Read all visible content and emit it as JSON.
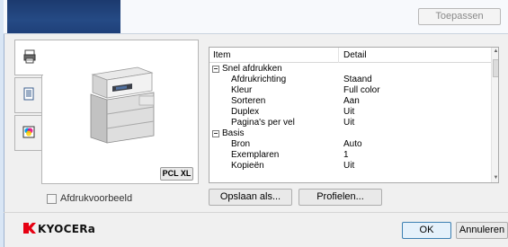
{
  "header": {
    "apply_label": "Toepassen"
  },
  "tabs": [
    {
      "icon": "printer-settings-icon"
    },
    {
      "icon": "document-icon"
    },
    {
      "icon": "color-icon"
    }
  ],
  "preview": {
    "badge": "PCL XL",
    "checkbox_label": "Afdrukvoorbeeld",
    "checkbox_checked": false
  },
  "table": {
    "col_item": "Item",
    "col_detail": "Detail",
    "rows": [
      {
        "item": "Snel afdrukken",
        "detail": "",
        "group": true
      },
      {
        "item": "Afdrukrichting",
        "detail": "Staand",
        "group": false
      },
      {
        "item": "Kleur",
        "detail": "Full color",
        "group": false
      },
      {
        "item": "Sorteren",
        "detail": "Aan",
        "group": false
      },
      {
        "item": "Duplex",
        "detail": "Uit",
        "group": false
      },
      {
        "item": "Pagina's per vel",
        "detail": "Uit",
        "group": false
      },
      {
        "item": "Basis",
        "detail": "",
        "group": true
      },
      {
        "item": "Bron",
        "detail": "Auto",
        "group": false
      },
      {
        "item": "Exemplaren",
        "detail": "1",
        "group": false
      },
      {
        "item": "Kopieën",
        "detail": "Uit",
        "group": false
      }
    ]
  },
  "buttons": {
    "save_as": "Opslaan als...",
    "profiles": "Profielen...",
    "ok": "OK",
    "cancel": "Annuleren"
  },
  "brand": {
    "name": "KYOCERa",
    "accent_color": "#e60012"
  }
}
